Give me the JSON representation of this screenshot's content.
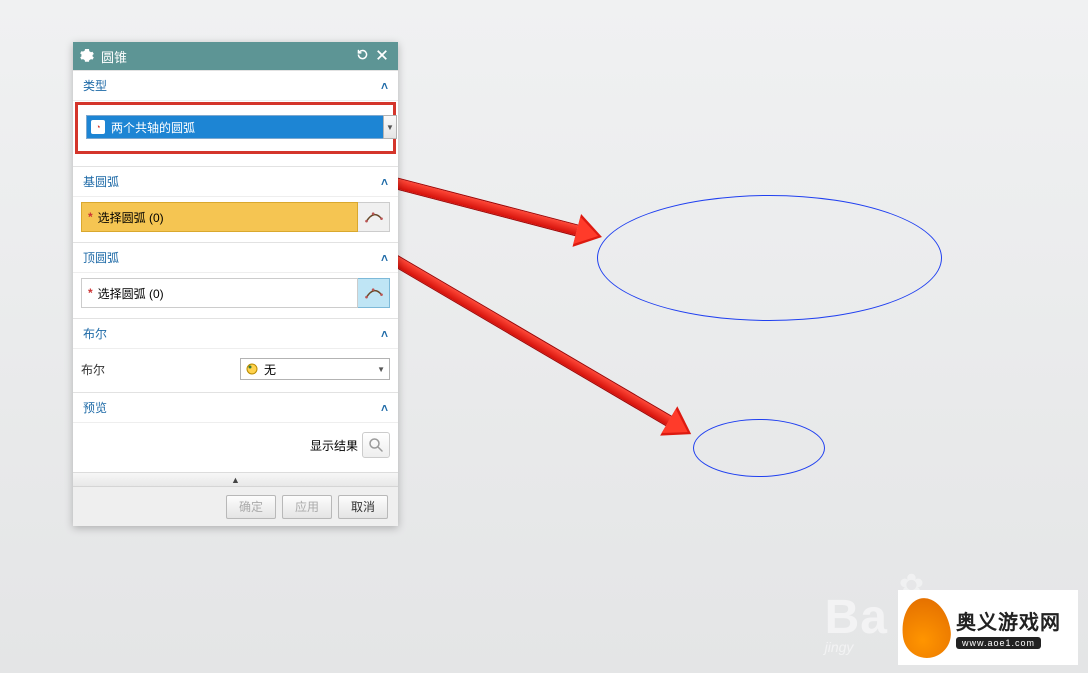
{
  "dialog": {
    "title": "圆锥",
    "sections": {
      "type": {
        "label": "类型",
        "selected": "两个共轴的圆弧"
      },
      "base_arc": {
        "label": "基圆弧",
        "select_label": "选择圆弧 (0)"
      },
      "top_arc": {
        "label": "顶圆弧",
        "select_label": "选择圆弧 (0)"
      },
      "boolean": {
        "label": "布尔",
        "field_label": "布尔",
        "value": "无"
      },
      "preview": {
        "label": "预览",
        "show_result": "显示结果"
      }
    },
    "buttons": {
      "ok": "确定",
      "apply": "应用",
      "cancel": "取消"
    }
  },
  "watermark": {
    "site_name": "奥义游戏网",
    "site_url": "www.aoe1.com",
    "bg_text": "Ba",
    "bg_sub": "jingy"
  }
}
